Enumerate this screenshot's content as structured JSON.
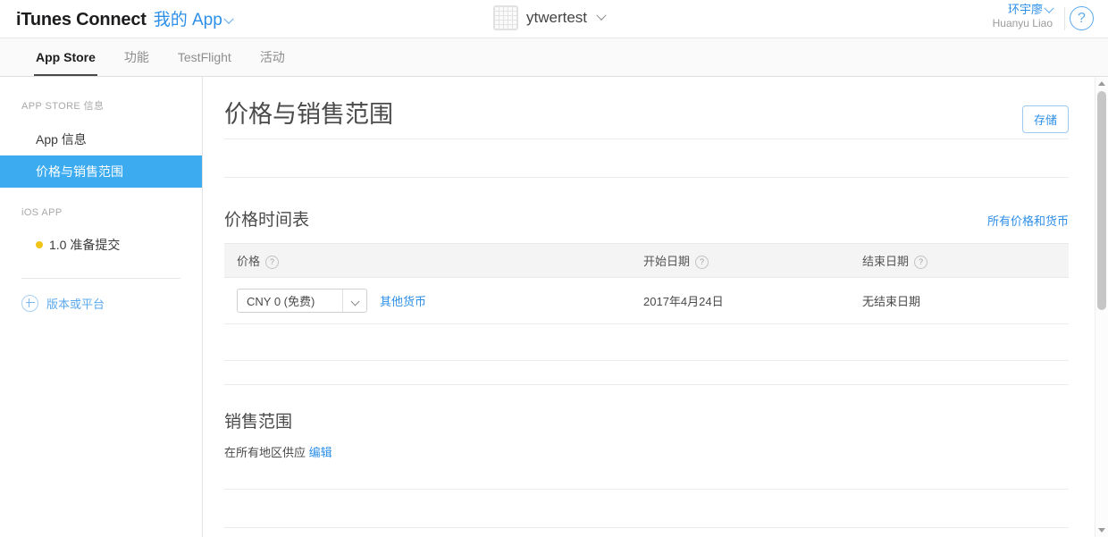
{
  "topbar": {
    "brand": "iTunes Connect",
    "my_app_label": "我的 App",
    "app_name": "ytwertest",
    "app_icon": "app-placeholder-grid-icon",
    "user_name_cn": "环宇廖",
    "user_name_en": "Huanyu Liao",
    "help_label": "?",
    "accent_color": "#2d8fe8"
  },
  "navtabs": [
    {
      "label": "App Store",
      "active": true
    },
    {
      "label": "功能",
      "active": false
    },
    {
      "label": "TestFlight",
      "active": false
    },
    {
      "label": "活动",
      "active": false
    }
  ],
  "sidebar": {
    "group1_title": "APP STORE 信息",
    "item_app_info": "App 信息",
    "item_pricing": "价格与销售范围",
    "group2_title": "iOS APP",
    "item_version": "1.0 准备提交",
    "version_status_color": "#f0c419",
    "add_label": "版本或平台"
  },
  "page": {
    "title": "价格与销售范围",
    "save_label": "存储"
  },
  "price_schedule": {
    "title": "价格时间表",
    "all_prices_link": "所有价格和货币",
    "columns": {
      "price": "价格",
      "start_date": "开始日期",
      "end_date": "结束日期",
      "help_glyph": "?"
    },
    "rows": [
      {
        "price_value": "CNY 0 (免费)",
        "other_currency_link": "其他货币",
        "start_date": "2017年4月24日",
        "end_date": "无结束日期"
      }
    ]
  },
  "availability": {
    "title": "销售范围",
    "status_text": "在所有地区供应",
    "edit_link": "编辑"
  },
  "scrollbar": {
    "up_arrow": "scroll-up-arrow-icon",
    "down_arrow": "scroll-down-arrow-icon"
  }
}
